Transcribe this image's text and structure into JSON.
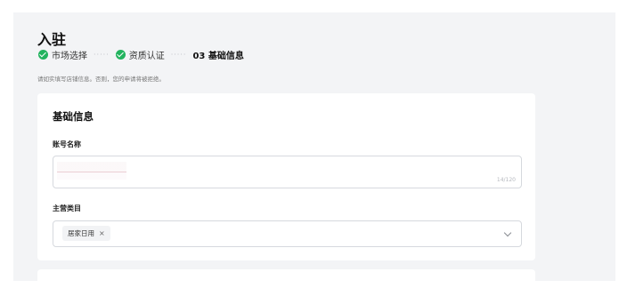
{
  "page": {
    "title": "入驻"
  },
  "steps": [
    {
      "label": "市场选择",
      "status": "done",
      "icon": "check-icon"
    },
    {
      "label": "资质认证",
      "status": "done",
      "icon": "check-icon"
    },
    {
      "label": "03 基础信息",
      "status": "current"
    }
  ],
  "step_separator": "·····",
  "notice": "请如实填写店铺信息。否则，您的申请将被拒绝。",
  "form": {
    "section_title": "基础信息",
    "account_name": {
      "label": "账号名称",
      "value": "",
      "counter": "14/120"
    },
    "category": {
      "label": "主营类目",
      "selected_tag": "居家日用",
      "tag_close": "×",
      "dropdown_icon": "chevron-down-icon"
    }
  },
  "colors": {
    "success": "#22b35e",
    "page_bg": "#f3f4f6",
    "card_bg": "#ffffff",
    "border": "#d6d9de"
  }
}
